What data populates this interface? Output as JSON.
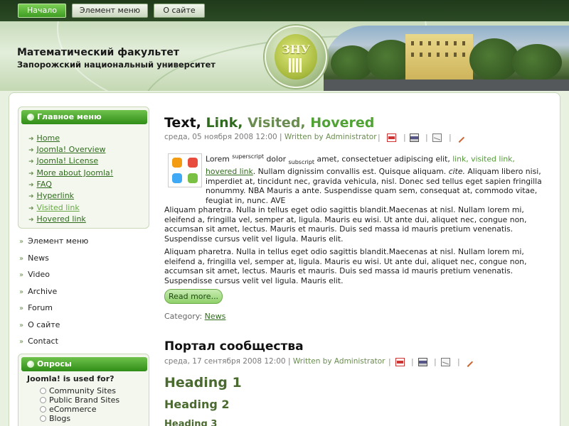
{
  "topnav": {
    "tabs": [
      {
        "label": "Начало",
        "active": true
      },
      {
        "label": "Элемент меню",
        "active": false
      },
      {
        "label": "О сайте",
        "active": false
      }
    ]
  },
  "header": {
    "faculty": "Математический факультет",
    "university": "Запорожский национальный университет",
    "logo_text": "ЗНУ"
  },
  "sidebar": {
    "main_menu_title": "Главное меню",
    "main_menu_items": [
      {
        "label": "Home"
      },
      {
        "label": "Joomla! Overview"
      },
      {
        "label": "Joomla! License"
      },
      {
        "label": "More about Joomla!"
      },
      {
        "label": "FAQ"
      },
      {
        "label": "Hyperlink"
      },
      {
        "label": "Visited link"
      },
      {
        "label": "Hovered link"
      }
    ],
    "secondary_items": [
      {
        "label": "Элемент меню"
      },
      {
        "label": "News"
      },
      {
        "label": "Video"
      },
      {
        "label": "Archive"
      },
      {
        "label": "Forum"
      },
      {
        "label": "О сайте"
      },
      {
        "label": "Contact"
      }
    ],
    "polls": {
      "title": "Опросы",
      "question": "Joomla! is used for?",
      "options": [
        {
          "label": "Community Sites"
        },
        {
          "label": "Public Brand Sites"
        },
        {
          "label": "eCommerce"
        },
        {
          "label": "Blogs"
        }
      ]
    }
  },
  "article1": {
    "title": {
      "text": "Text,",
      "link": "Link,",
      "visited": "Visited,",
      "hovered": "Hovered"
    },
    "date": "среда, 05 ноября 2008 12:00",
    "separator": "|",
    "written_by": "Written by Administrator",
    "intro": {
      "lorem": "Lorem",
      "superscript": "superscript",
      "dolor": "dolor",
      "subscript": "subscript",
      "amet": "amet, consectetuer adipiscing elit,",
      "link": "link,",
      "visited_link": "visited link,",
      "hovered_link": "hovered link",
      "text_after_link": ". Nullam dignissim convallis est. Quisque aliquam.",
      "cite": "cite.",
      "rest": "Aliquam libero nisi, imperdiet at, tincidunt nec, gravida vehicula, nisl. Donec sed tellus eget sapien fringilla nonummy. NBA Mauris a ante. Suspendisse quam sem, consequat at, commodo vitae, feugiat in, nunc. AVE"
    },
    "para1": "Aliquam pharetra. Nulla in tellus eget odio sagittis blandit.Maecenas at nisl. Nullam lorem mi, eleifend a, fringilla vel, semper at, ligula. Mauris eu wisi. Ut ante dui, aliquet nec, congue non, accumsan sit amet, lectus. Mauris et mauris. Duis sed massa id mauris pretium venenatis. Suspendisse cursus velit vel ligula. Mauris elit.",
    "para2": "Aliquam pharetra. Nulla in tellus eget odio sagittis blandit.Maecenas at nisl. Nullam lorem mi, eleifend a, fringilla vel, semper at, ligula. Mauris eu wisi. Ut ante dui, aliquet nec, congue non, accumsan sit amet, lectus. Mauris et mauris. Duis sed massa id mauris pretium venenatis. Suspendisse cursus velit vel ligula. Mauris elit.",
    "read_more": "Read more...",
    "category_label": "Category:",
    "category": "News"
  },
  "article2": {
    "title": "Портал сообщества",
    "date": "среда, 17 сентября 2008 12:00",
    "separator": "|",
    "written_by": "Written by Administrator",
    "heading1": "Heading 1",
    "heading2": "Heading 2",
    "heading3": "Heading 3"
  },
  "icons": [
    "pdf-icon",
    "print-icon",
    "email-icon",
    "edit-icon",
    "arrow-icon",
    "poll-dot-icon"
  ],
  "colors": {
    "accent_green": "#3e9c22",
    "link": "#2f6b1c",
    "visited": "#6a8c50",
    "hovered": "#4fa233"
  }
}
